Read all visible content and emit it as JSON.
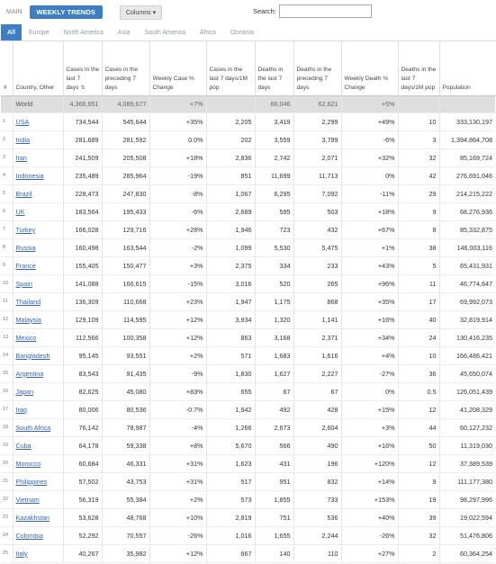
{
  "topbar": {
    "main_label": "MAIN",
    "weekly_label": "WEEKLY TRENDS",
    "columns_label": "Columns",
    "search_label": "Search:",
    "search_value": ""
  },
  "tabs": [
    "All",
    "Europe",
    "North America",
    "Asia",
    "South America",
    "Africa",
    "Oceania"
  ],
  "headers": [
    "#",
    "Country, Other",
    "Cases in the last 7 days",
    "Cases in the preceding 7 days",
    "Weekly Case % Change",
    "Cases in the last 7 days/1M pop",
    "Deaths in the last 7 days",
    "Deaths in the preceding 7 days",
    "Weekly Death % Change",
    "Deaths in the last 7 days/1M pop",
    "Population"
  ],
  "world_row": [
    "",
    "World",
    "4,366,651",
    "4,089,677",
    "+7%",
    "",
    "66,046",
    "62,621",
    "+5%",
    "",
    ""
  ],
  "rows": [
    [
      "1",
      "USA",
      "734,544",
      "545,644",
      "+35%",
      "2,205",
      "3,419",
      "2,299",
      "+49%",
      "10",
      "333,130,197"
    ],
    [
      "2",
      "India",
      "281,689",
      "281,592",
      "0.0%",
      "202",
      "3,559",
      "3,799",
      "-6%",
      "3",
      "1,394,864,708"
    ],
    [
      "3",
      "Iran",
      "241,509",
      "205,508",
      "+18%",
      "2,836",
      "2,742",
      "2,071",
      "+32%",
      "32",
      "85,169,724"
    ],
    [
      "4",
      "Indonesia",
      "235,489",
      "285,964",
      "-19%",
      "851",
      "11,699",
      "11,713",
      "0%",
      "42",
      "276,691,046"
    ],
    [
      "5",
      "Brazil",
      "228,473",
      "247,830",
      "-8%",
      "1,067",
      "6,295",
      "7,092",
      "-11%",
      "29",
      "214,215,222"
    ],
    [
      "6",
      "UK",
      "183,564",
      "195,433",
      "-6%",
      "2,689",
      "595",
      "503",
      "+18%",
      "9",
      "68,276,936"
    ],
    [
      "7",
      "Turkey",
      "166,028",
      "129,716",
      "+28%",
      "1,946",
      "723",
      "432",
      "+67%",
      "8",
      "85,332,875"
    ],
    [
      "8",
      "Russia",
      "160,498",
      "163,544",
      "-2%",
      "1,099",
      "5,530",
      "5,475",
      "+1%",
      "38",
      "146,003,116"
    ],
    [
      "9",
      "France",
      "155,405",
      "150,477",
      "+3%",
      "2,375",
      "334",
      "233",
      "+43%",
      "5",
      "65,431,931"
    ],
    [
      "10",
      "Spain",
      "141,088",
      "166,615",
      "-15%",
      "3,016",
      "520",
      "265",
      "+96%",
      "11",
      "46,774,647"
    ],
    [
      "11",
      "Thailand",
      "136,309",
      "110,668",
      "+23%",
      "1,947",
      "1,175",
      "868",
      "+35%",
      "17",
      "69,992,073"
    ],
    [
      "12",
      "Malaysia",
      "129,109",
      "114,595",
      "+12%",
      "3,934",
      "1,320",
      "1,141",
      "+16%",
      "40",
      "32,819,914"
    ],
    [
      "13",
      "Mexico",
      "112,566",
      "100,358",
      "+12%",
      "863",
      "3,168",
      "2,371",
      "+34%",
      "24",
      "130,416,235"
    ],
    [
      "14",
      "Bangladesh",
      "95,145",
      "93,551",
      "+2%",
      "571",
      "1,683",
      "1,616",
      "+4%",
      "10",
      "166,486,421"
    ],
    [
      "15",
      "Argentina",
      "83,543",
      "91,435",
      "-9%",
      "1,830",
      "1,627",
      "2,227",
      "-27%",
      "36",
      "45,650,074"
    ],
    [
      "16",
      "Japan",
      "82,625",
      "45,080",
      "+83%",
      "655",
      "67",
      "67",
      "0%",
      "0.5",
      "126,051,439"
    ],
    [
      "17",
      "Iraq",
      "80,006",
      "80,536",
      "-0.7%",
      "1,942",
      "492",
      "428",
      "+15%",
      "12",
      "41,208,329"
    ],
    [
      "18",
      "South Africa",
      "76,142",
      "78,987",
      "-4%",
      "1,266",
      "2,673",
      "2,604",
      "+3%",
      "44",
      "60,127,232"
    ],
    [
      "19",
      "Cuba",
      "64,178",
      "59,338",
      "+8%",
      "5,670",
      "566",
      "490",
      "+16%",
      "50",
      "11,319,030"
    ],
    [
      "20",
      "Morocco",
      "60,684",
      "46,331",
      "+31%",
      "1,623",
      "431",
      "196",
      "+120%",
      "12",
      "37,389,539"
    ],
    [
      "21",
      "Philippines",
      "57,502",
      "43,753",
      "+31%",
      "517",
      "951",
      "832",
      "+14%",
      "9",
      "111,177,380"
    ],
    [
      "22",
      "Vietnam",
      "56,319",
      "55,384",
      "+2%",
      "573",
      "1,855",
      "733",
      "+153%",
      "19",
      "98,297,996"
    ],
    [
      "23",
      "Kazakhstan",
      "53,628",
      "48,768",
      "+10%",
      "2,819",
      "751",
      "536",
      "+40%",
      "39",
      "19,022,594"
    ],
    [
      "24",
      "Colombia",
      "52,292",
      "70,557",
      "-26%",
      "1,016",
      "1,655",
      "2,244",
      "-26%",
      "32",
      "51,476,806"
    ],
    [
      "25",
      "Italy",
      "40,267",
      "35,982",
      "+12%",
      "667",
      "140",
      "110",
      "+27%",
      "2",
      "60,364,254"
    ]
  ],
  "colors": {
    "accent": "#3d7ec4",
    "link": "#3366bb",
    "world_bg": "#dedede"
  }
}
